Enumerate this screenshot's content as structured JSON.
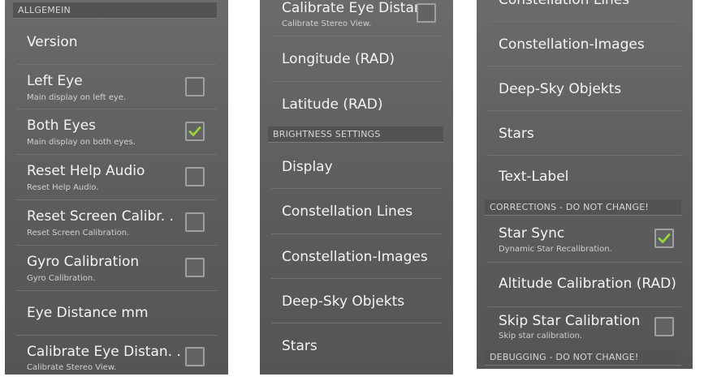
{
  "colors": {
    "check_accent": "#9bd43a",
    "panel_bg": "#5e5f60",
    "header_bg": "#525354"
  },
  "panel1": {
    "header": "ALLGEMEIN",
    "items": [
      {
        "title": "Version",
        "subtitle": ""
      },
      {
        "title": "Left Eye",
        "subtitle": "Main display on left eye.",
        "checked": false
      },
      {
        "title": "Both Eyes",
        "subtitle": "Main display on both eyes.",
        "checked": true
      },
      {
        "title": "Reset Help Audio",
        "subtitle": "Reset Help Audio.",
        "checked": false
      },
      {
        "title": "Reset Screen Calibr. .",
        "subtitle": "Reset Screen Calibration.",
        "checked": false
      },
      {
        "title": "Gyro Calibration",
        "subtitle": "Gyro Calibration.",
        "checked": false
      },
      {
        "title": "Eye Distance mm",
        "subtitle": ""
      },
      {
        "title": "Calibrate Eye Distan. .",
        "subtitle": "Calibrate Stereo View.",
        "checked": false
      }
    ]
  },
  "panel2": {
    "items_top": [
      {
        "title": "Calibrate Eye Distan. .",
        "subtitle": "Calibrate Stereo View.",
        "checked": false
      },
      {
        "title": "Longitude (RAD)"
      },
      {
        "title": "Latitude (RAD)"
      }
    ],
    "header": "BRIGHTNESS SETTINGS",
    "items_bottom": [
      {
        "title": "Display"
      },
      {
        "title": "Constellation Lines"
      },
      {
        "title": "Constellation-Images"
      },
      {
        "title": "Deep-Sky Objekts"
      },
      {
        "title": "Stars"
      }
    ]
  },
  "panel3": {
    "items_top": [
      {
        "title": "Constellation Lines"
      },
      {
        "title": "Constellation-Images"
      },
      {
        "title": "Deep-Sky Objekts"
      },
      {
        "title": "Stars"
      },
      {
        "title": "Text-Label"
      }
    ],
    "header_corrections": "CORRECTIONS - DO NOT CHANGE!",
    "items_bottom": [
      {
        "title": "Star Sync",
        "subtitle": "Dynamic Star Recalibration.",
        "checked": true
      },
      {
        "title": "Altitude Calibration (RAD)"
      },
      {
        "title": "Skip Star Calibration",
        "subtitle": "Skip star calibration.",
        "checked": false
      }
    ],
    "header_debugging": "DEBUGGING - DO NOT CHANGE!"
  }
}
